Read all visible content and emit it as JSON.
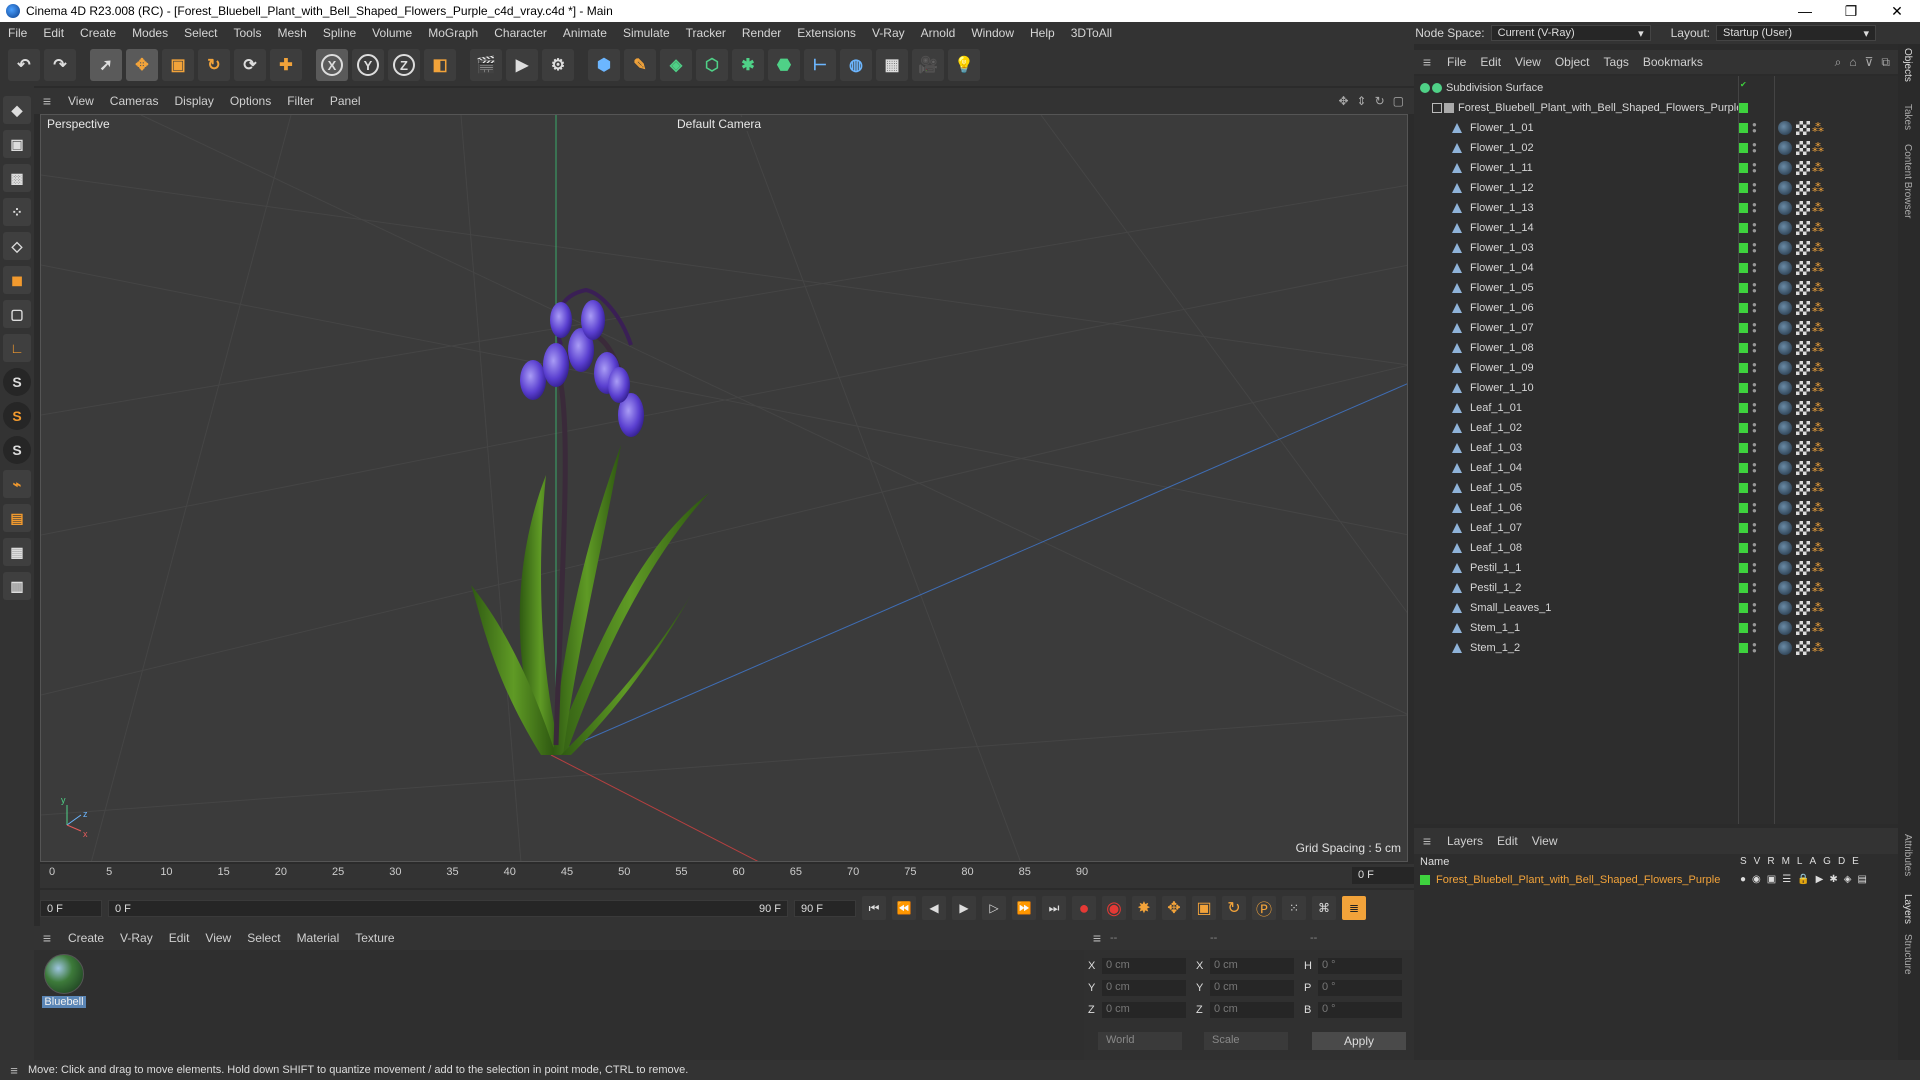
{
  "window": {
    "title": "Cinema 4D R23.008 (RC) - [Forest_Bluebell_Plant_with_Bell_Shaped_Flowers_Purple_c4d_vray.c4d *] - Main",
    "minimize": "—",
    "maximize": "❐",
    "close": "✕"
  },
  "menu": {
    "items": [
      "File",
      "Edit",
      "Create",
      "Modes",
      "Select",
      "Tools",
      "Mesh",
      "Spline",
      "Volume",
      "MoGraph",
      "Character",
      "Animate",
      "Simulate",
      "Tracker",
      "Render",
      "Extensions",
      "V-Ray",
      "Arnold",
      "Window",
      "Help",
      "3DToAll"
    ],
    "node_space_label": "Node Space:",
    "node_space_value": "Current (V-Ray)",
    "layout_label": "Layout:",
    "layout_value": "Startup (User)"
  },
  "viewport": {
    "menu": [
      "View",
      "Cameras",
      "Display",
      "Options",
      "Filter",
      "Panel"
    ],
    "label": "Perspective",
    "camera": "Default Camera",
    "grid_spacing": "Grid Spacing : 5 cm",
    "axis_y": "y",
    "axis_z": "z",
    "axis_x": "x"
  },
  "timeline": {
    "ticks": [
      "0",
      "5",
      "10",
      "15",
      "20",
      "25",
      "30",
      "35",
      "40",
      "45",
      "50",
      "55",
      "60",
      "65",
      "70",
      "75",
      "80",
      "85",
      "90"
    ],
    "current_frame": "0 F",
    "start": "0 F",
    "range_start": "0 F",
    "range_end": "90 F",
    "end": "90 F"
  },
  "material_manager": {
    "menu": [
      "Create",
      "V-Ray",
      "Edit",
      "View",
      "Select",
      "Material",
      "Texture"
    ],
    "material_name": "Bluebell"
  },
  "coordinates": {
    "header": [
      "--",
      "--",
      "--"
    ],
    "rows": [
      {
        "a": "X",
        "av": "0 cm",
        "b": "X",
        "bv": "0 cm",
        "c": "H",
        "cv": "0 °"
      },
      {
        "a": "Y",
        "av": "0 cm",
        "b": "Y",
        "bv": "0 cm",
        "c": "P",
        "cv": "0 °"
      },
      {
        "a": "Z",
        "av": "0 cm",
        "b": "Z",
        "bv": "0 cm",
        "c": "B",
        "cv": "0 °"
      }
    ],
    "world": "World",
    "scale": "Scale",
    "apply": "Apply"
  },
  "status": "Move: Click and drag to move elements. Hold down SHIFT to quantize movement / add to the selection in point mode, CTRL to remove.",
  "object_manager": {
    "menu": [
      "File",
      "Edit",
      "View",
      "Object",
      "Tags",
      "Bookmarks"
    ],
    "root": "Subdivision Surface",
    "group": "Forest_Bluebell_Plant_with_Bell_Shaped_Flowers_Purple",
    "objects": [
      "Flower_1_01",
      "Flower_1_02",
      "Flower_1_11",
      "Flower_1_12",
      "Flower_1_13",
      "Flower_1_14",
      "Flower_1_03",
      "Flower_1_04",
      "Flower_1_05",
      "Flower_1_06",
      "Flower_1_07",
      "Flower_1_08",
      "Flower_1_09",
      "Flower_1_10",
      "Leaf_1_01",
      "Leaf_1_02",
      "Leaf_1_03",
      "Leaf_1_04",
      "Leaf_1_05",
      "Leaf_1_06",
      "Leaf_1_07",
      "Leaf_1_08",
      "Pestil_1_1",
      "Pestil_1_2",
      "Small_Leaves_1",
      "Stem_1_1",
      "Stem_1_2"
    ]
  },
  "layers": {
    "menu": [
      "Layers",
      "Edit",
      "View"
    ],
    "col_name": "Name",
    "cols": [
      "S",
      "V",
      "R",
      "M",
      "L",
      "A",
      "G",
      "D",
      "E"
    ],
    "layer": "Forest_Bluebell_Plant_with_Bell_Shaped_Flowers_Purple"
  },
  "side_tabs": [
    "Objects",
    "Takes",
    "Content Browser",
    "Attributes",
    "Layers",
    "Structure"
  ],
  "colors": {
    "accent": "#f2a33a",
    "visible": "#3ed23e",
    "selection": "#5a85b5"
  }
}
